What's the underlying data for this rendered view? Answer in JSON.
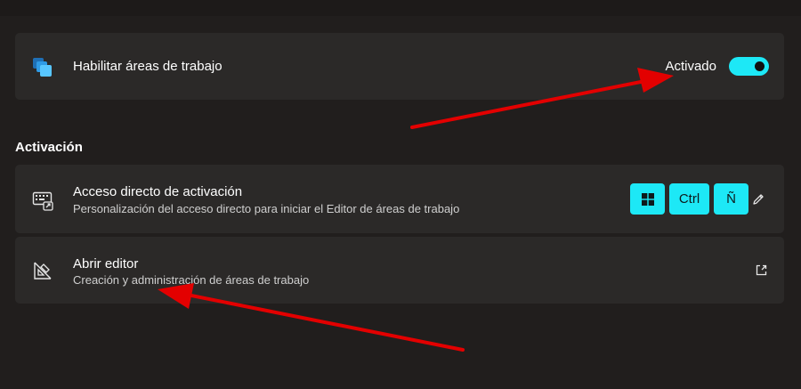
{
  "enable_card": {
    "title": "Habilitar áreas de trabajo",
    "status": "Activado",
    "toggle_on": true,
    "icon": "workspaces-icon"
  },
  "section": {
    "heading": "Activación"
  },
  "shortcut_card": {
    "title": "Acceso directo de activación",
    "subtitle": "Personalización del acceso directo para iniciar el Editor de áreas de trabajo",
    "icon": "keyboard-shortcut-icon",
    "keys": [
      "win",
      "Ctrl",
      "Ñ"
    ],
    "edit_icon": "pencil-icon"
  },
  "editor_card": {
    "title": "Abrir editor",
    "subtitle": "Creación y administración de áreas de trabajo",
    "icon": "editor-icon",
    "action_icon": "external-link-icon"
  },
  "colors": {
    "accent": "#1de8f6",
    "card_bg": "#2b2928",
    "page_bg": "#211e1d",
    "annotation_arrow": "#e30000"
  }
}
